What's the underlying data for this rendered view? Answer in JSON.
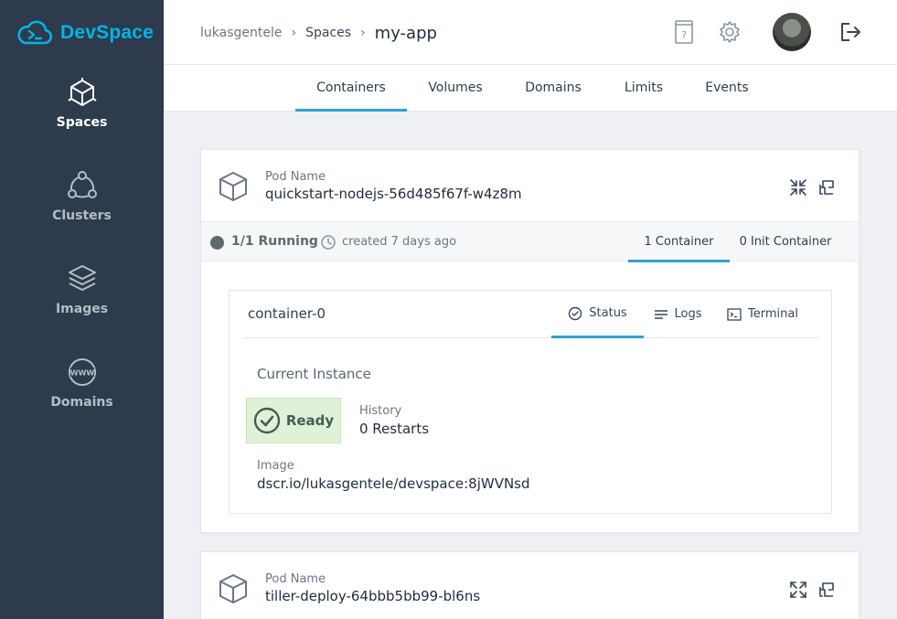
{
  "app": {
    "name": "DevSpace",
    "accent": "#00b5e8"
  },
  "sidebar": {
    "items": [
      {
        "label": "Spaces",
        "icon": "cube-icon",
        "active": true
      },
      {
        "label": "Clusters",
        "icon": "cluster-icon",
        "active": false
      },
      {
        "label": "Images",
        "icon": "layers-icon",
        "active": false
      },
      {
        "label": "Domains",
        "icon": "www-globe-icon",
        "active": false
      }
    ]
  },
  "header": {
    "breadcrumb": [
      "lukasgentele",
      "Spaces",
      "my-app"
    ],
    "icons": [
      "docs-icon",
      "gear-icon",
      "avatar",
      "logout-icon"
    ]
  },
  "tabs": [
    "Containers",
    "Volumes",
    "Domains",
    "Limits",
    "Events"
  ],
  "active_tab": "Containers",
  "pods": [
    {
      "label": "Pod Name",
      "name": "quickstart-nodejs-56d485f67f-w4z8m",
      "status": "1/1 Running",
      "created": "created 7 days ago",
      "container_tabs": [
        "1 Container",
        "0 Init Container"
      ],
      "container": {
        "name": "container-0",
        "tabs": [
          "Status",
          "Logs",
          "Terminal"
        ],
        "current_instance": "Current Instance",
        "ready": "Ready",
        "history_label": "History",
        "history_value": "0 Restarts",
        "image_label": "Image",
        "image_value": "dscr.io/lukasgentele/devspace:8jWVNsd"
      }
    },
    {
      "label": "Pod Name",
      "name": "tiller-deploy-64bbb5bb99-bl6ns"
    }
  ]
}
